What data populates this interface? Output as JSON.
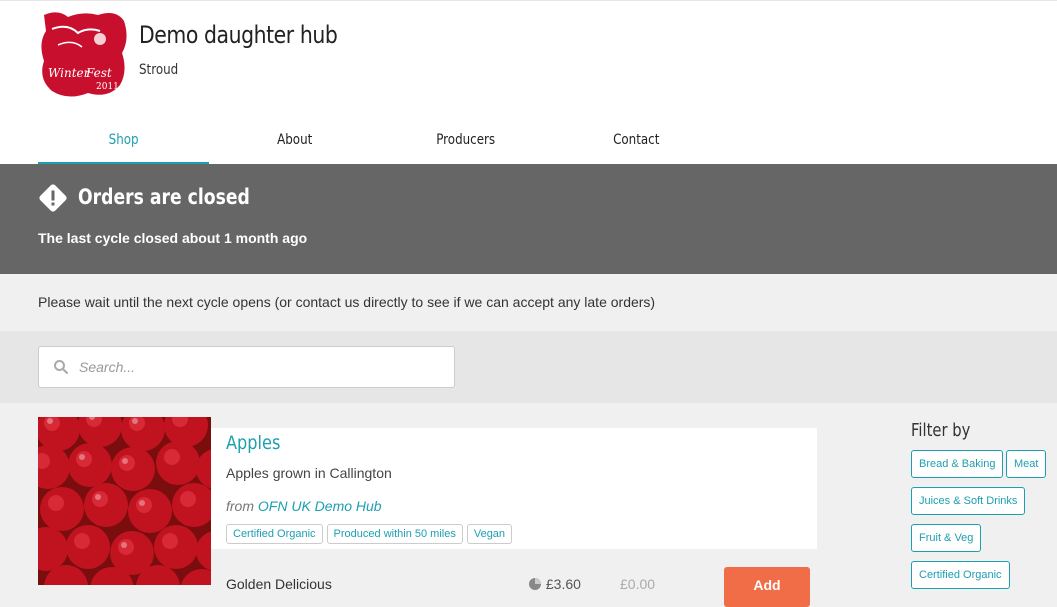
{
  "header": {
    "hub_name": "Demo daughter hub",
    "location": "Stroud",
    "tabs": [
      {
        "label": "Shop",
        "active": true
      },
      {
        "label": "About",
        "active": false
      },
      {
        "label": "Producers",
        "active": false
      },
      {
        "label": "Contact",
        "active": false
      }
    ]
  },
  "banner": {
    "title": "Orders are closed",
    "subtitle": "The last cycle closed about 1 month ago"
  },
  "wait_message": "Please wait until the next cycle opens (or contact us directly to see if we can accept any late orders)",
  "search": {
    "placeholder": "Search..."
  },
  "product": {
    "name": "Apples",
    "description": "Apples grown in Callington",
    "from_label": "from",
    "from_hub": "OFN UK Demo Hub",
    "tags": [
      "Certified Organic",
      "Produced within 50 miles",
      "Vegan"
    ],
    "variant": {
      "name": "Golden Delicious",
      "price": "£3.60",
      "total": "£0.00",
      "add_label": "Add"
    }
  },
  "filters": {
    "title": "Filter by",
    "items": [
      "Bread & Baking",
      "Meat",
      "Juices & Soft Drinks",
      "Fruit & Veg",
      "Certified Organic"
    ]
  },
  "colors": {
    "accent": "#1d9fb1",
    "banner": "#666666",
    "add_button": "#f06d47"
  }
}
